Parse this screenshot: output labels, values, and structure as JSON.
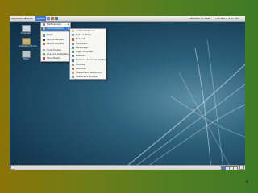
{
  "topbar": {
    "menus": [
      "Applications",
      "Places",
      "System"
    ],
    "active_menu": "System",
    "user": "Lubbidan Michael",
    "clock": "Thu Nov 6  8:31 AM"
  },
  "desktop_icons": [
    {
      "label": "Computer",
      "icon": "computer-icon"
    },
    {
      "label": "Lubbidan's Home",
      "icon": "home-folder-icon"
    },
    {
      "label": "Trash",
      "icon": "trash-icon"
    }
  ],
  "system_menu": {
    "items": [
      {
        "label": "Preferences",
        "icon": "preferences-icon",
        "submenu": true
      },
      {
        "label": "Administration",
        "icon": "administration-icon",
        "submenu": true,
        "selected": true
      },
      {
        "separator": true
      },
      {
        "label": "Help",
        "icon": "help-icon"
      },
      {
        "label": "About GNOME",
        "icon": "gnome-icon"
      },
      {
        "label": "About Ubuntu",
        "icon": "ubuntu-icon"
      },
      {
        "separator": true
      },
      {
        "label": "Lock Screen",
        "icon": "lock-icon"
      },
      {
        "label": "Log Out Lubbidan...",
        "icon": "logout-icon"
      },
      {
        "label": "Shut Down...",
        "icon": "shutdown-icon"
      }
    ]
  },
  "admin_menu": {
    "items": [
      {
        "label": "Authentications",
        "icon": "key-icon"
      },
      {
        "label": "Date & Time",
        "icon": "clock-icon"
      },
      {
        "label": "Firewall",
        "icon": "firewall-icon"
      },
      {
        "label": "Hardware",
        "icon": "hardware-icon"
      },
      {
        "label": "Language",
        "icon": "language-icon"
      },
      {
        "label": "Login Window",
        "icon": "login-window-icon"
      },
      {
        "label": "Network",
        "icon": "network-icon"
      },
      {
        "label": "Network Services Control",
        "icon": "network-services-icon"
      },
      {
        "label": "Printing",
        "icon": "printer-icon"
      },
      {
        "label": "Services",
        "icon": "services-icon"
      },
      {
        "label": "Shared and Retention",
        "icon": "shared-folders-icon"
      },
      {
        "label": "Users and Groups",
        "icon": "users-groups-icon"
      }
    ]
  },
  "colors": {
    "selection": "#3f76c6",
    "panel": "#e0e0e0",
    "desktop": "#1d4a66"
  }
}
